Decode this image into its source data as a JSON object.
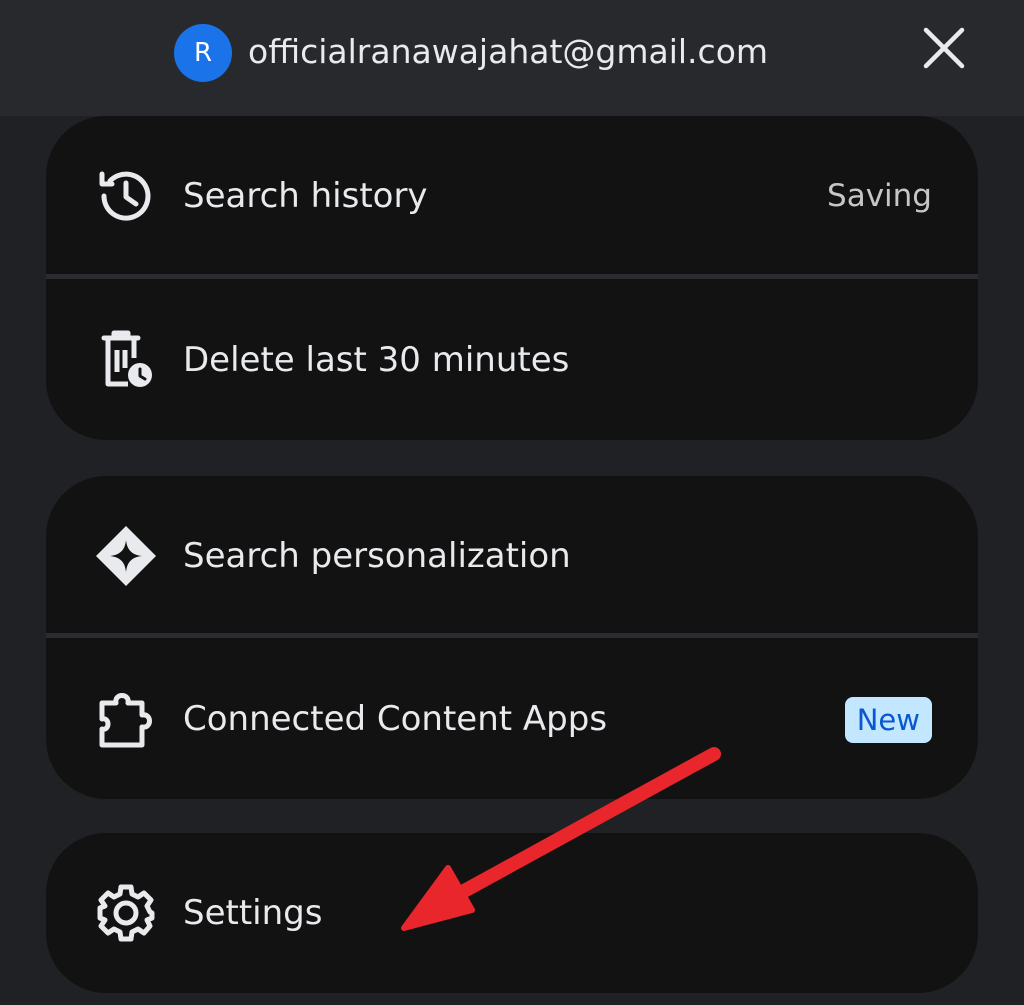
{
  "header": {
    "avatar_letter": "R",
    "email": "officialranawajahat@gmail.com",
    "close_icon": "close-icon"
  },
  "groups": [
    {
      "items": [
        {
          "label": "Search history",
          "icon": "history-icon",
          "trailing": "Saving"
        },
        {
          "label": "Delete last 30 minutes",
          "icon": "delete-clock-icon"
        }
      ]
    },
    {
      "items": [
        {
          "label": "Search personalization",
          "icon": "sparkle-icon"
        },
        {
          "label": "Connected Content Apps",
          "icon": "puzzle-icon",
          "badge": "New"
        }
      ]
    },
    {
      "items": [
        {
          "label": "Settings",
          "icon": "gear-icon"
        }
      ]
    }
  ],
  "colors": {
    "background": "#202124",
    "card": "#121212",
    "avatar": "#1a73e8",
    "badge_bg": "#c2e7ff",
    "badge_text": "#0b57d0",
    "annotation_arrow": "#e8262b"
  }
}
